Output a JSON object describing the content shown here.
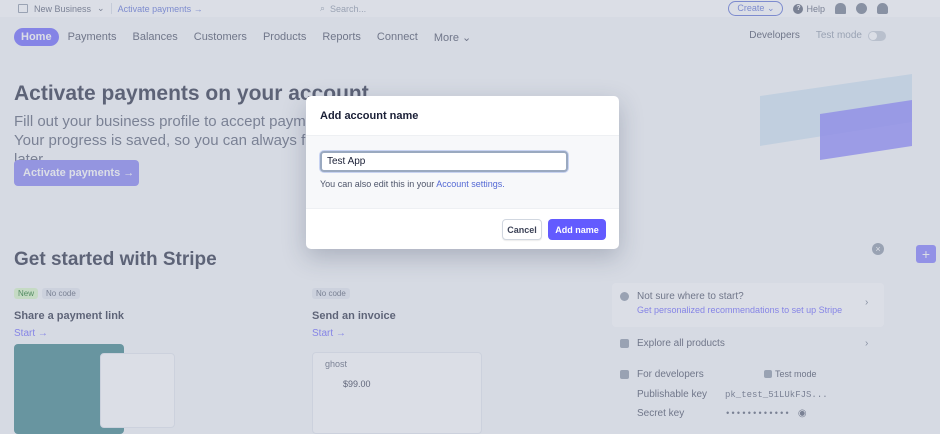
{
  "topbar": {
    "business_name": "New Business",
    "activate_link": "Activate payments",
    "search_placeholder": "Search...",
    "create_label": "Create",
    "help_label": "Help"
  },
  "nav": {
    "items": [
      "Home",
      "Payments",
      "Balances",
      "Customers",
      "Products",
      "Reports",
      "Connect",
      "More"
    ],
    "active_index": 0,
    "developers": "Developers",
    "test_mode": "Test mode"
  },
  "hero": {
    "title": "Activate payments on your account",
    "subtitle": "Fill out your business profile to accept payments. Your progress is saved, so you can always finish later.",
    "button": "Activate payments"
  },
  "get_started": {
    "title": "Get started with Stripe",
    "cards": [
      {
        "badges": [
          "New",
          "No code"
        ],
        "title": "Share a payment link",
        "link": "Start"
      },
      {
        "badges": [
          "No code"
        ],
        "title": "Send an invoice",
        "link": "Start",
        "thumb_label": "ghost",
        "thumb_price": "$99.00"
      }
    ]
  },
  "sidebar": {
    "help_title": "Not sure where to start?",
    "help_sub": "Get personalized recommendations to set up Stripe",
    "explore": "Explore all products",
    "developers_title": "For developers",
    "test_mode": "Test mode",
    "publishable_label": "Publishable key",
    "publishable_value": "pk_test_51LUkFJS...",
    "secret_label": "Secret key",
    "secret_value": "••••••••••••"
  },
  "modal": {
    "title": "Add account name",
    "input_value": "Test App",
    "help_prefix": "You can also edit this in your",
    "help_link": "Account settings.",
    "cancel": "Cancel",
    "submit": "Add name"
  },
  "colors": {
    "accent": "#635bff",
    "overlay": "#afb6c8",
    "hero_art": "#7a73ff"
  }
}
